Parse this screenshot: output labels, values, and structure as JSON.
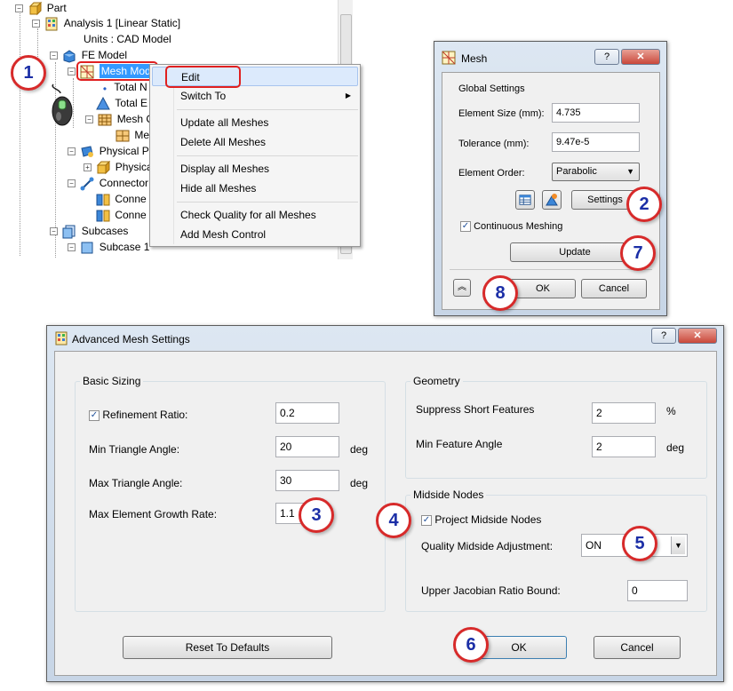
{
  "tree": {
    "items": [
      {
        "label": "Part",
        "icon": "part-icon"
      },
      {
        "label": "Analysis 1 [Linear Static]",
        "icon": "analysis-icon"
      },
      {
        "label": "Units : CAD Model",
        "icon": ""
      },
      {
        "label": "FE Model",
        "icon": "fe-model-icon"
      },
      {
        "label": "Mesh Mod",
        "icon": "mesh-icon"
      },
      {
        "label": "Total N",
        "icon": "dot-icon"
      },
      {
        "label": "Total E",
        "icon": "element-icon"
      },
      {
        "label": "Mesh C",
        "icon": "mesh-control-icon"
      },
      {
        "label": "Me",
        "icon": "mesh-grid-icon"
      },
      {
        "label": "Physical Pr",
        "icon": "physical-icon"
      },
      {
        "label": "Physica",
        "icon": "cube-icon"
      },
      {
        "label": "Connector",
        "icon": "connector-icon"
      },
      {
        "label": "Conne",
        "icon": "connection-icon"
      },
      {
        "label": "Conne",
        "icon": "connection-icon"
      },
      {
        "label": "Subcases",
        "icon": "subcases-icon"
      },
      {
        "label": "Subcase 1",
        "icon": "subcase-icon"
      }
    ]
  },
  "context_menu": {
    "items": [
      "Edit",
      "Switch To",
      "Update all Meshes",
      "Delete All Meshes",
      "Display all Meshes",
      "Hide all Meshes",
      "Check Quality for all Meshes",
      "Add Mesh Control"
    ]
  },
  "mesh_dialog": {
    "title": "Mesh",
    "help": "?",
    "global_settings": "Global Settings",
    "element_size_label": "Element Size (mm):",
    "element_size_value": "4.735",
    "tolerance_label": "Tolerance (mm):",
    "tolerance_value": "9.47e-5",
    "element_order_label": "Element Order:",
    "element_order_value": "Parabolic",
    "settings_button": "Settings",
    "continuous_meshing": "Continuous Meshing",
    "update_button": "Update",
    "ok_button": "OK",
    "cancel_button": "Cancel"
  },
  "adv_dialog": {
    "title": "Advanced Mesh Settings",
    "help": "?",
    "basic_sizing": "Basic Sizing",
    "refinement_ratio_label": "Refinement Ratio:",
    "refinement_ratio_value": "0.2",
    "min_tri_label": "Min Triangle Angle:",
    "min_tri_value": "20",
    "min_tri_unit": "deg",
    "max_tri_label": "Max Triangle Angle:",
    "max_tri_value": "30",
    "max_tri_unit": "deg",
    "growth_label": "Max Element Growth Rate:",
    "growth_value": "1.1",
    "geometry": "Geometry",
    "suppress_label": "Suppress Short Features",
    "suppress_value": "2",
    "suppress_unit": "%",
    "min_feature_label": "Min Feature Angle",
    "min_feature_value": "2",
    "min_feature_unit": "deg",
    "midside_nodes": "Midside Nodes",
    "project_midside": "Project Midside Nodes",
    "quality_adj_label": "Quality Midside Adjustment:",
    "quality_adj_value": "ON",
    "jacobian_label": "Upper Jacobian Ratio Bound:",
    "jacobian_value": "0",
    "reset_button": "Reset To Defaults",
    "ok_button": "OK",
    "cancel_button": "Cancel"
  },
  "callouts": [
    "1",
    "2",
    "3",
    "4",
    "5",
    "6",
    "7",
    "8"
  ],
  "colors": {
    "callout_border": "#d72a2a",
    "callout_text": "#1b2ea6",
    "highlight": "#e02020",
    "close_button": "#c9483b"
  }
}
